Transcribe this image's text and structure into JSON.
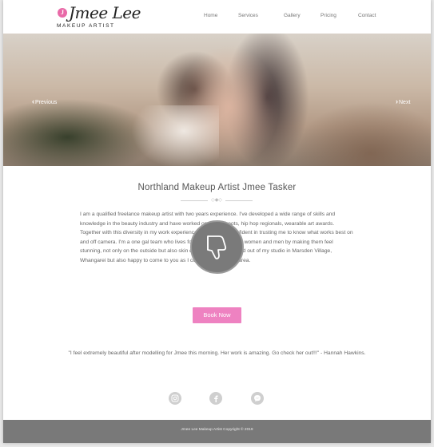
{
  "header": {
    "logo_badge": "J",
    "logo_script": "Jmee Lee",
    "logo_sub": "MAKEUP ARTIST",
    "nav": [
      {
        "label": "Home"
      },
      {
        "label": "Services"
      },
      {
        "label": "Gallery"
      },
      {
        "label": "Pricing"
      },
      {
        "label": "Contact"
      }
    ]
  },
  "hero": {
    "prev_label": "Previous",
    "next_label": "Next"
  },
  "main": {
    "title": "Northland Makeup Artist Jmee Tasker",
    "bio": "I am a qualified freelance makeup artist with two years experience. I've developed a wide range of skills and knowledge in the beauty industry and have worked on photoshoots, hip hop regionals, wearable art awards. Together with this diversity in my work experience, you can feel confident in trusting me to know what works best on and off camera. I'm a one gal team who lives for helping empowering women and men by making them feel stunning, not only on the outside but also skin deep. I am home based out of my studio in Marsden Village, Whangarei but also happy to come to you as I cover the Northland area.",
    "book_label": "Book Now",
    "quote": "\"I feel extremely beautiful after modelling for Jmee this morning. Her work is amazing. Go check her out!!!\" - Hannah Hawkins."
  },
  "social": [
    {
      "icon": "instagram-icon"
    },
    {
      "icon": "facebook-icon"
    },
    {
      "icon": "messenger-icon"
    }
  ],
  "overlay": {
    "icon": "thumbs-down-icon"
  },
  "footer": {
    "copyright": "Jmee Lee Makeup Artist Copyright © 2019"
  },
  "colors": {
    "accent": "#ee82c1",
    "badge": "#e96aa8",
    "footer_bg": "#797979"
  }
}
